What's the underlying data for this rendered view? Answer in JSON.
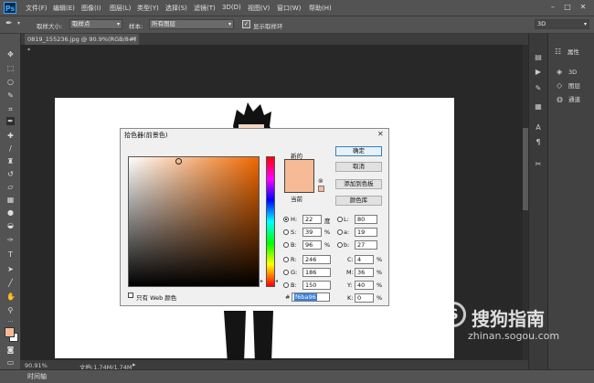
{
  "app": {
    "logo": "Ps",
    "menu": [
      "文件(F)",
      "编辑(E)",
      "图像(I)",
      "图层(L)",
      "类型(Y)",
      "选择(S)",
      "滤镜(T)",
      "3D(D)",
      "视图(V)",
      "窗口(W)",
      "帮助(H)"
    ],
    "window_controls": [
      "–",
      "□",
      "✕"
    ]
  },
  "options": {
    "sample_size_label": "取样大小:",
    "sample_size_value": "取样点",
    "sample_label": "样本:",
    "sample_value": "所有图层",
    "show_ring_label": "显示取样环",
    "workspace_value": "3D"
  },
  "document": {
    "tab_title": "0819_155236.jpg @ 90.9%(RGB/8#) *",
    "zoom": "90.91%",
    "doc_info": "文档:1.74M/1.74M"
  },
  "panels": {
    "properties": "属性",
    "threed": "3D",
    "layers": "图层",
    "channels": "通道"
  },
  "timeline": "时间轴",
  "dialog": {
    "title": "拾色器(前景色)",
    "close": "✕",
    "new_label": "新的",
    "current_label": "当前",
    "buttons": {
      "ok": "确定",
      "cancel": "取消",
      "add_swatch": "添加到色板",
      "color_libraries": "颜色库"
    },
    "hsb": {
      "h_label": "H:",
      "h_value": "22",
      "h_unit": "度",
      "s_label": "S:",
      "s_value": "39",
      "s_unit": "%",
      "b_label": "B:",
      "b_value": "96",
      "b_unit": "%"
    },
    "rgb": {
      "r_label": "R:",
      "r_value": "246",
      "g_label": "G:",
      "g_value": "186",
      "b_label": "B:",
      "b_value": "150"
    },
    "lab": {
      "l_label": "L:",
      "l_value": "80",
      "a_label": "a:",
      "a_value": "19",
      "b_label": "b:",
      "b_value": "27"
    },
    "cmyk": {
      "c_label": "C:",
      "c_value": "4",
      "m_label": "M:",
      "m_value": "36",
      "y_label": "Y:",
      "y_value": "40",
      "k_label": "K:",
      "k_value": "0",
      "unit": "%"
    },
    "hex_label": "#",
    "hex_value": "f6ba96",
    "web_only_label": "只有 Web 颜色",
    "selected_color": "#f6ba96"
  },
  "watermark": {
    "logo_char": "S",
    "text": "搜狗指南",
    "url": "zhinan.sogou.com"
  },
  "colors": {
    "foreground": "#f6ba96",
    "background": "#ffffff",
    "chrome": "#535353"
  }
}
